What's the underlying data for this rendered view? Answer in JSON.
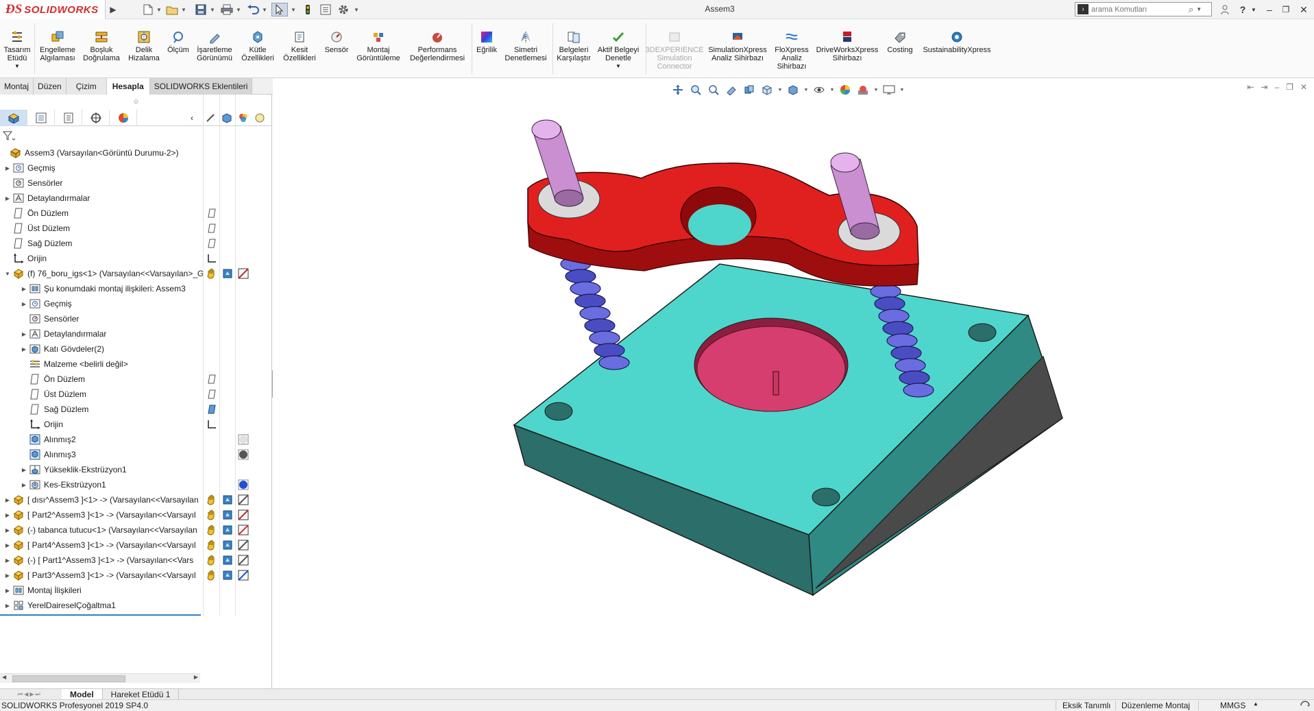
{
  "app": {
    "brand": "SOLIDWORKS",
    "document_title": "Assem3"
  },
  "search": {
    "placeholder": "arama Komutları"
  },
  "toolbar": {
    "tools": [
      {
        "label1": "Tasarım",
        "label2": "Etüdü",
        "icon": "design-study-icon"
      },
      {
        "label1": "Engelleme",
        "label2": "Algılaması",
        "icon": "interference-icon"
      },
      {
        "label1": "Boşluk",
        "label2": "Doğrulama",
        "icon": "clearance-icon"
      },
      {
        "label1": "Delik",
        "label2": "Hizalama",
        "icon": "hole-alignment-icon"
      },
      {
        "label1": "Ölçüm",
        "label2": "",
        "icon": "measure-icon"
      },
      {
        "label1": "İşaretleme",
        "label2": "Görünümü",
        "icon": "markup-icon"
      },
      {
        "label1": "Kütle",
        "label2": "Özellikleri",
        "icon": "mass-properties-icon"
      },
      {
        "label1": "Kesit",
        "label2": "Özellikleri",
        "icon": "section-properties-icon"
      },
      {
        "label1": "Sensör",
        "label2": "",
        "icon": "sensor-icon"
      },
      {
        "label1": "Montaj",
        "label2": "Görüntüleme",
        "icon": "assembly-visualization-icon"
      },
      {
        "label1": "Performans",
        "label2": "Değerlendirmesi",
        "icon": "performance-icon"
      },
      {
        "label1": "Eğrilik",
        "label2": "",
        "icon": "curvature-icon"
      },
      {
        "label1": "Simetri",
        "label2": "Denetlemesi",
        "icon": "symmetry-icon"
      },
      {
        "label1": "Belgeleri",
        "label2": "Karşılaştır",
        "icon": "compare-icon"
      },
      {
        "label1": "Aktif Belgeyi",
        "label2": "Denetle",
        "icon": "check-document-icon"
      },
      {
        "label1": "3DEXPERIENCE",
        "label2": "Simulation",
        "label3": "Connector",
        "icon": "3dexperience-icon"
      },
      {
        "label1": "SimulationXpress",
        "label2": "Analiz Sihirbazı",
        "icon": "simulationxpress-icon"
      },
      {
        "label1": "FloXpress",
        "label2": "Analiz",
        "label3": "Sihirbazı",
        "icon": "floxpress-icon"
      },
      {
        "label1": "DriveWorksXpress",
        "label2": "Sihirbazı",
        "icon": "driveworksxpress-icon"
      },
      {
        "label1": "Costing",
        "label2": "",
        "icon": "costing-icon"
      },
      {
        "label1": "SustainabilityXpress",
        "label2": "",
        "icon": "sustainability-icon"
      }
    ]
  },
  "cm_tabs": [
    "Montaj",
    "Düzen",
    "Çizim",
    "Hesapla",
    "SOLIDWORKS Eklentileri"
  ],
  "cm_tab_active": "Hesapla",
  "tree": [
    {
      "label": "Assem3  (Varsayılan<Görüntü Durumu-2>)",
      "indent": 0,
      "exp": "",
      "icon": "assembly-icon"
    },
    {
      "label": "Geçmiş",
      "indent": 1,
      "exp": "▶",
      "icon": "history-icon"
    },
    {
      "label": "Sensörler",
      "indent": 1,
      "exp": "",
      "icon": "sensors-icon"
    },
    {
      "label": "Detaylandırmalar",
      "indent": 1,
      "exp": "▶",
      "icon": "annotations-icon"
    },
    {
      "label": "Ön Düzlem",
      "indent": 1,
      "exp": "",
      "icon": "plane-icon"
    },
    {
      "label": "Üst Düzlem",
      "indent": 1,
      "exp": "",
      "icon": "plane-icon"
    },
    {
      "label": "Sağ Düzlem",
      "indent": 1,
      "exp": "",
      "icon": "plane-icon"
    },
    {
      "label": "Orijin",
      "indent": 1,
      "exp": "",
      "icon": "origin-icon"
    },
    {
      "label": "(f) 76_boru_igs<1> (Varsayılan<<Varsayılan>_G",
      "indent": 1,
      "exp": "▼",
      "icon": "part-icon"
    },
    {
      "label": "Şu konumdaki montaj ilişkileri: Assem3",
      "indent": 2,
      "exp": "▶",
      "icon": "mates-icon"
    },
    {
      "label": "Geçmiş",
      "indent": 2,
      "exp": "▶",
      "icon": "history-icon"
    },
    {
      "label": "Sensörler",
      "indent": 2,
      "exp": "",
      "icon": "sensors-icon"
    },
    {
      "label": "Detaylandırmalar",
      "indent": 2,
      "exp": "▶",
      "icon": "annotations-icon"
    },
    {
      "label": "Katı Gövdeler(2)",
      "indent": 2,
      "exp": "▶",
      "icon": "solid-bodies-icon"
    },
    {
      "label": "Malzeme <belirli değil>",
      "indent": 2,
      "exp": "",
      "icon": "material-icon"
    },
    {
      "label": "Ön Düzlem",
      "indent": 2,
      "exp": "",
      "icon": "plane-icon"
    },
    {
      "label": "Üst Düzlem",
      "indent": 2,
      "exp": "",
      "icon": "plane-icon"
    },
    {
      "label": "Sağ Düzlem",
      "indent": 2,
      "exp": "",
      "icon": "plane-icon"
    },
    {
      "label": "Orijin",
      "indent": 2,
      "exp": "",
      "icon": "origin-icon"
    },
    {
      "label": "Alınmış2",
      "indent": 2,
      "exp": "",
      "icon": "imported-icon"
    },
    {
      "label": "Alınmış3",
      "indent": 2,
      "exp": "",
      "icon": "imported-icon"
    },
    {
      "label": "Yükseklik-Ekstrüzyon1",
      "indent": 2,
      "exp": "▶",
      "icon": "boss-extrude-icon"
    },
    {
      "label": "Kes-Ekstrüzyon1",
      "indent": 2,
      "exp": "▶",
      "icon": "cut-extrude-icon"
    },
    {
      "label": "[ dısı^Assem3 ]<1> -> (Varsayılan<<Varsayılan",
      "indent": 1,
      "exp": "▶",
      "icon": "part-icon"
    },
    {
      "label": "[ Part2^Assem3 ]<1> -> (Varsayılan<<Varsayıl",
      "indent": 1,
      "exp": "▶",
      "icon": "part-icon"
    },
    {
      "label": "(-) tabanca tutucu<1> (Varsayılan<<Varsayılan",
      "indent": 1,
      "exp": "▶",
      "icon": "part-icon"
    },
    {
      "label": "[ Part4^Assem3 ]<1> -> (Varsayılan<<Varsayıl",
      "indent": 1,
      "exp": "▶",
      "icon": "part-icon"
    },
    {
      "label": "(-) [ Part1^Assem3 ]<1> -> (Varsayılan<<Vars",
      "indent": 1,
      "exp": "▶",
      "icon": "part-icon"
    },
    {
      "label": "[ Part3^Assem3 ]<1> -> (Varsayılan<<Varsayıl",
      "indent": 1,
      "exp": "▶",
      "icon": "part-icon"
    },
    {
      "label": "Montaj İlişkileri",
      "indent": 1,
      "exp": "▶",
      "icon": "mates-icon"
    },
    {
      "label": "YerelDaireselÇoğaltma1",
      "indent": 1,
      "exp": "▶",
      "icon": "pattern-icon"
    }
  ],
  "bottom_tabs": [
    "Model",
    "Hareket Etüdü 1"
  ],
  "bottom_tab_active": "Model",
  "status": {
    "product": "SOLIDWORKS Profesyonel 2019 SP4.0",
    "definition": "Eksik Tanımlı",
    "mode": "Düzenleme Montaj",
    "units": "MMGS"
  },
  "colors": {
    "base_plate": "#4fd6cc",
    "clamp": "#e0201f",
    "pins": "#c98fd0",
    "springs": "#4a4dc2",
    "bowl": "#d63e70",
    "brand": "#d42b2b"
  }
}
